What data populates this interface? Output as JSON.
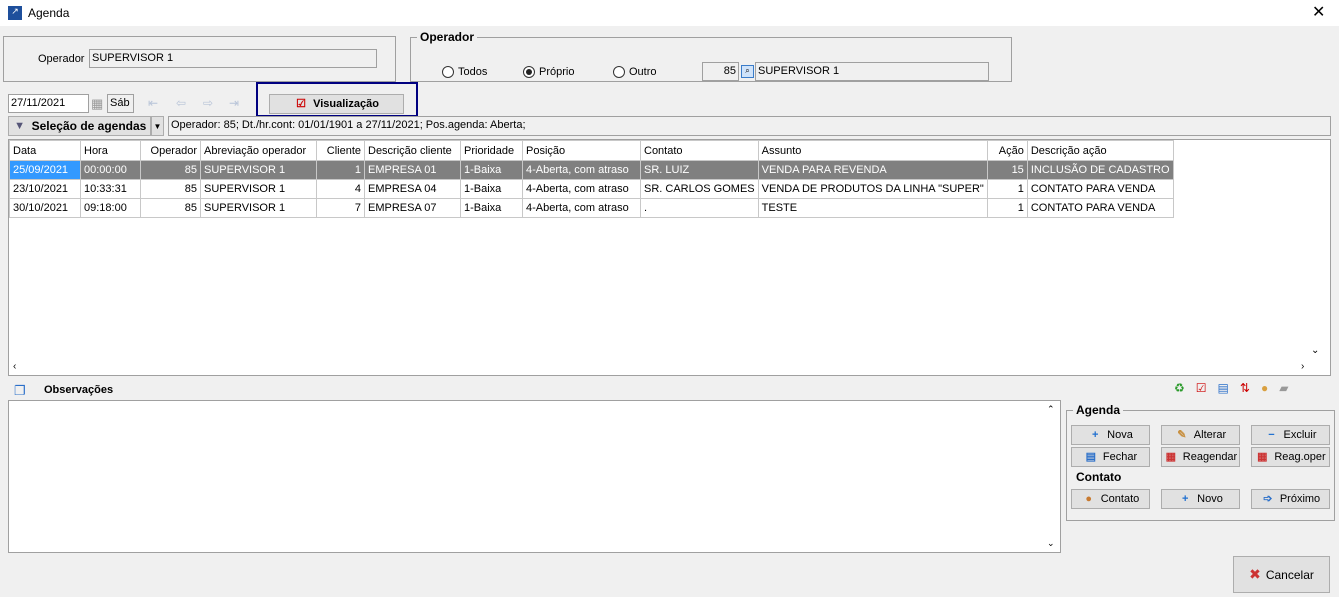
{
  "window": {
    "title": "Agenda",
    "close": "✕"
  },
  "operator_field": {
    "label": "Operador",
    "value": "SUPERVISOR 1"
  },
  "operador_group": {
    "legend": "Operador",
    "options": [
      {
        "label": "Todos",
        "selected": false
      },
      {
        "label": "Próprio",
        "selected": true
      },
      {
        "label": "Outro",
        "selected": false
      }
    ],
    "code": "85",
    "name": "SUPERVISOR 1"
  },
  "toolbar": {
    "date": "27/11/2021",
    "weekday": "Sáb",
    "view_button": "Visualização",
    "selection_button": "Seleção de agendas",
    "filter_text": "Operador: 85; Dt./hr.cont: 01/01/1901 a 27/11/2021; Pos.agenda: Aberta;"
  },
  "table": {
    "columns": [
      "Data",
      "Hora",
      "Operador",
      "Abreviação operador",
      "Cliente",
      "Descrição cliente",
      "Prioridade",
      "Posição",
      "Contato",
      "Assunto",
      "Ação",
      "Descrição ação"
    ],
    "rows": [
      [
        "25/09/2021",
        "00:00:00",
        "85",
        "SUPERVISOR 1",
        "1",
        "EMPRESA 01",
        "1-Baixa",
        "4-Aberta, com atraso",
        "SR. LUIZ",
        "VENDA PARA REVENDA",
        "15",
        "INCLUSÃO DE CADASTRO"
      ],
      [
        "23/10/2021",
        "10:33:31",
        "85",
        "SUPERVISOR 1",
        "4",
        "EMPRESA 04",
        "1-Baixa",
        "4-Aberta, com atraso",
        "SR. CARLOS GOMES",
        "VENDA DE PRODUTOS DA LINHA \"SUPER\"",
        "1",
        "CONTATO PARA VENDA"
      ],
      [
        "30/10/2021",
        "09:18:00",
        "85",
        "SUPERVISOR 1",
        "7",
        "EMPRESA 07",
        "1-Baixa",
        "4-Aberta, com atraso",
        ".",
        "TESTE",
        "1",
        "CONTATO PARA VENDA"
      ]
    ],
    "selected_row": 0
  },
  "observacoes": {
    "label": "Observações",
    "text": ""
  },
  "agenda_group": {
    "legend": "Agenda",
    "buttons": [
      "Nova",
      "Alterar",
      "Excluir",
      "Fechar",
      "Reagendar",
      "Reag.oper"
    ]
  },
  "contato_group": {
    "legend": "Contato",
    "buttons": [
      "Contato",
      "Novo",
      "Próximo"
    ]
  },
  "cancel_button": "Cancelar",
  "colors": {
    "highlight_border": "#000080",
    "selected_row": "#808080",
    "selected_cell": "#3399ff"
  }
}
